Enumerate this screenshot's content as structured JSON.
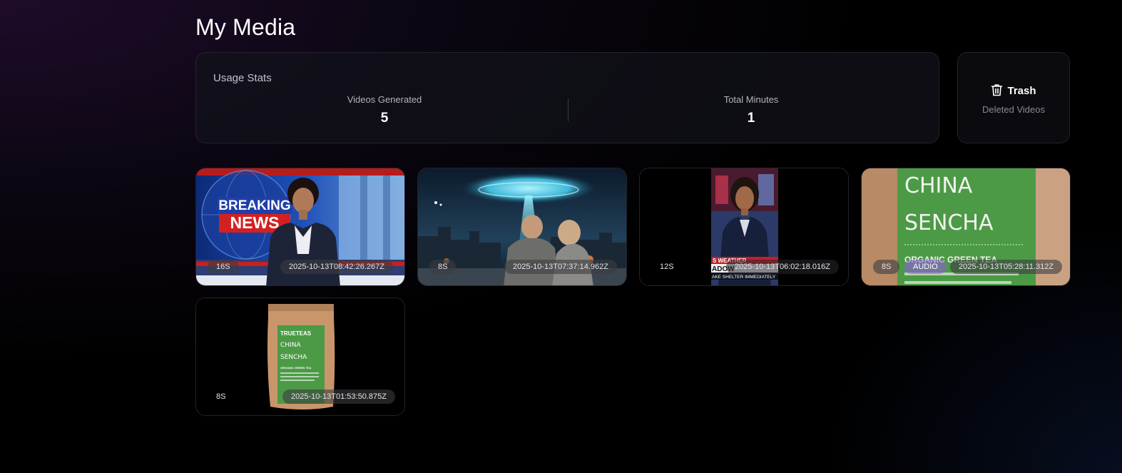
{
  "page": {
    "title": "My Media"
  },
  "usage_stats": {
    "title": "Usage Stats",
    "videos_generated_label": "Videos Generated",
    "videos_generated_value": "5",
    "total_minutes_label": "Total Minutes",
    "total_minutes_value": "1"
  },
  "trash": {
    "label": "Trash",
    "subtitle": "Deleted Videos",
    "icon": "trash-icon"
  },
  "videos": [
    {
      "duration": "16S",
      "created": "2025-10-13T08:42:26.267Z",
      "thumbnail": "breaking-news-anchor",
      "thumb_text": [
        "BREAKING",
        "NEWS"
      ]
    },
    {
      "duration": "8S",
      "created": "2025-10-13T07:37:14.962Z",
      "thumbnail": "ufo-city-night"
    },
    {
      "duration": "12S",
      "created": "2025-10-13T06:02:18.016Z",
      "thumbnail": "weather-anchor",
      "thumb_text": [
        "S WEATHER",
        "ADOW",
        "AKE SHELTER IMMEDIATELY"
      ]
    },
    {
      "duration": "8S",
      "badge": "AUDIO",
      "created": "2025-10-13T05:28:11.312Z",
      "thumbnail": "tea-package-closeup",
      "thumb_text": [
        "CHINA",
        "SENCHA",
        "ORGANIC GREEN TEA"
      ]
    },
    {
      "duration": "8S",
      "created": "2025-10-13T01:53:50.875Z",
      "thumbnail": "tea-package",
      "thumb_text": [
        "TRUETEAS",
        "CHINA",
        "SENCHA",
        "ORGANIC GREEN TEA"
      ]
    }
  ],
  "colors": {
    "background": "#000000",
    "card_border": "#23232c",
    "audio_badge": "#965ae6",
    "tea_green": "#4c9a46"
  }
}
